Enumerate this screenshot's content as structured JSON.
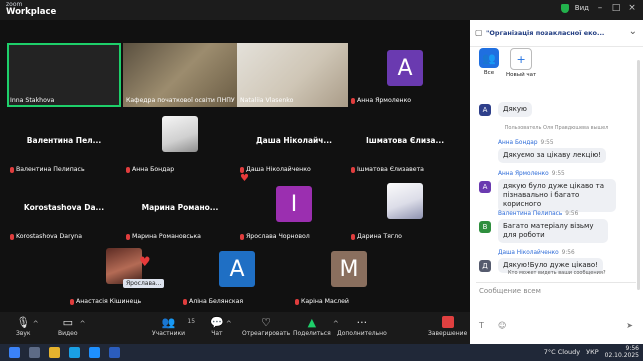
{
  "app": {
    "brand_top": "zoom",
    "brand_bottom": "Workplace",
    "view_label": "Вид"
  },
  "participants_top": [
    {
      "name": "Inna Stakhova",
      "type": "video"
    },
    {
      "name": "Кафедра початкової освіти ПНПУ",
      "type": "video"
    },
    {
      "name": "Nataliia Vlasenko",
      "type": "video"
    },
    {
      "name": "Анна Ярмоленко",
      "type": "avatar",
      "letter": "А",
      "color": "#6a3ab0"
    }
  ],
  "participants_grid": [
    {
      "big": "Валентина  Пел...",
      "name": "Валентина Пелипась"
    },
    {
      "big": "",
      "name": "Анна Бондар"
    },
    {
      "big": "Даша  Ніколайч...",
      "name": "Даша Ніколайченко"
    },
    {
      "big": "Ішматова  Єлиза...",
      "name": "Ішматова Єлизавета"
    },
    {
      "big": "Korostashova  Da...",
      "name": "Korostashova Daryna"
    },
    {
      "big": "Марина  Романо...",
      "name": "Марина Романовська"
    },
    {
      "big": "",
      "name": "Ярослава Чорновол",
      "letter": "I",
      "color": "#9b2fb0"
    },
    {
      "big": "",
      "name": "Дарина Тягло"
    },
    {
      "big": "",
      "name": "Анастасія Кішинець"
    },
    {
      "big": "",
      "name": "Аліна Белянская",
      "letter": "А",
      "color": "#1f6fc4"
    },
    {
      "big": "",
      "name": "Каріна Маслей",
      "letter": "М",
      "color": "#8a6f5e"
    }
  ],
  "reaction_badge": "Ярослава...",
  "toolbar": {
    "audio": "Звук",
    "video": "Видео",
    "participants": "Участники",
    "participants_count": "15",
    "chat": "Чат",
    "react": "Отреагировать",
    "share": "Поделиться",
    "more": "Дополнительно",
    "leave": "Завершение"
  },
  "chat": {
    "title": "\"Організація позакласної еко...",
    "tab_all": "Все",
    "tab_new": "Новый чат",
    "messages": [
      {
        "sender": "",
        "time": "",
        "text": "Дякую",
        "letter": "А",
        "color": "#2e3f8a"
      },
      {
        "sender": "Анна Бондар",
        "time": "9:55",
        "text": "Дякуємо за цікаву лекцію!",
        "letter": "",
        "color": ""
      },
      {
        "sender": "Анна Ярмоленко",
        "time": "9:55",
        "text": "дякую було дуже цікаво та пізнавально і багато корисного",
        "letter": "А",
        "color": "#6a3ab0"
      },
      {
        "sender": "Валентина Пелипась",
        "time": "9:56",
        "text": "Багато матеріалу візьму для роботи",
        "letter": "В",
        "color": "#2f8f3e"
      },
      {
        "sender": "Даша Ніколайченко",
        "time": "9:56",
        "text": "Дякую!Було дуже цікаво!",
        "letter": "Д",
        "color": "#555b6e"
      }
    ],
    "system_note": "Пользователь Оля Правдюшева вышел",
    "who_sees": "Кто может видеть ваши сообщения?",
    "input_placeholder": "Сообщение всем"
  },
  "taskbar": {
    "weather": "7°C Cloudy",
    "lang": "УКР",
    "time": "9:56",
    "date": "02.10.2025"
  }
}
